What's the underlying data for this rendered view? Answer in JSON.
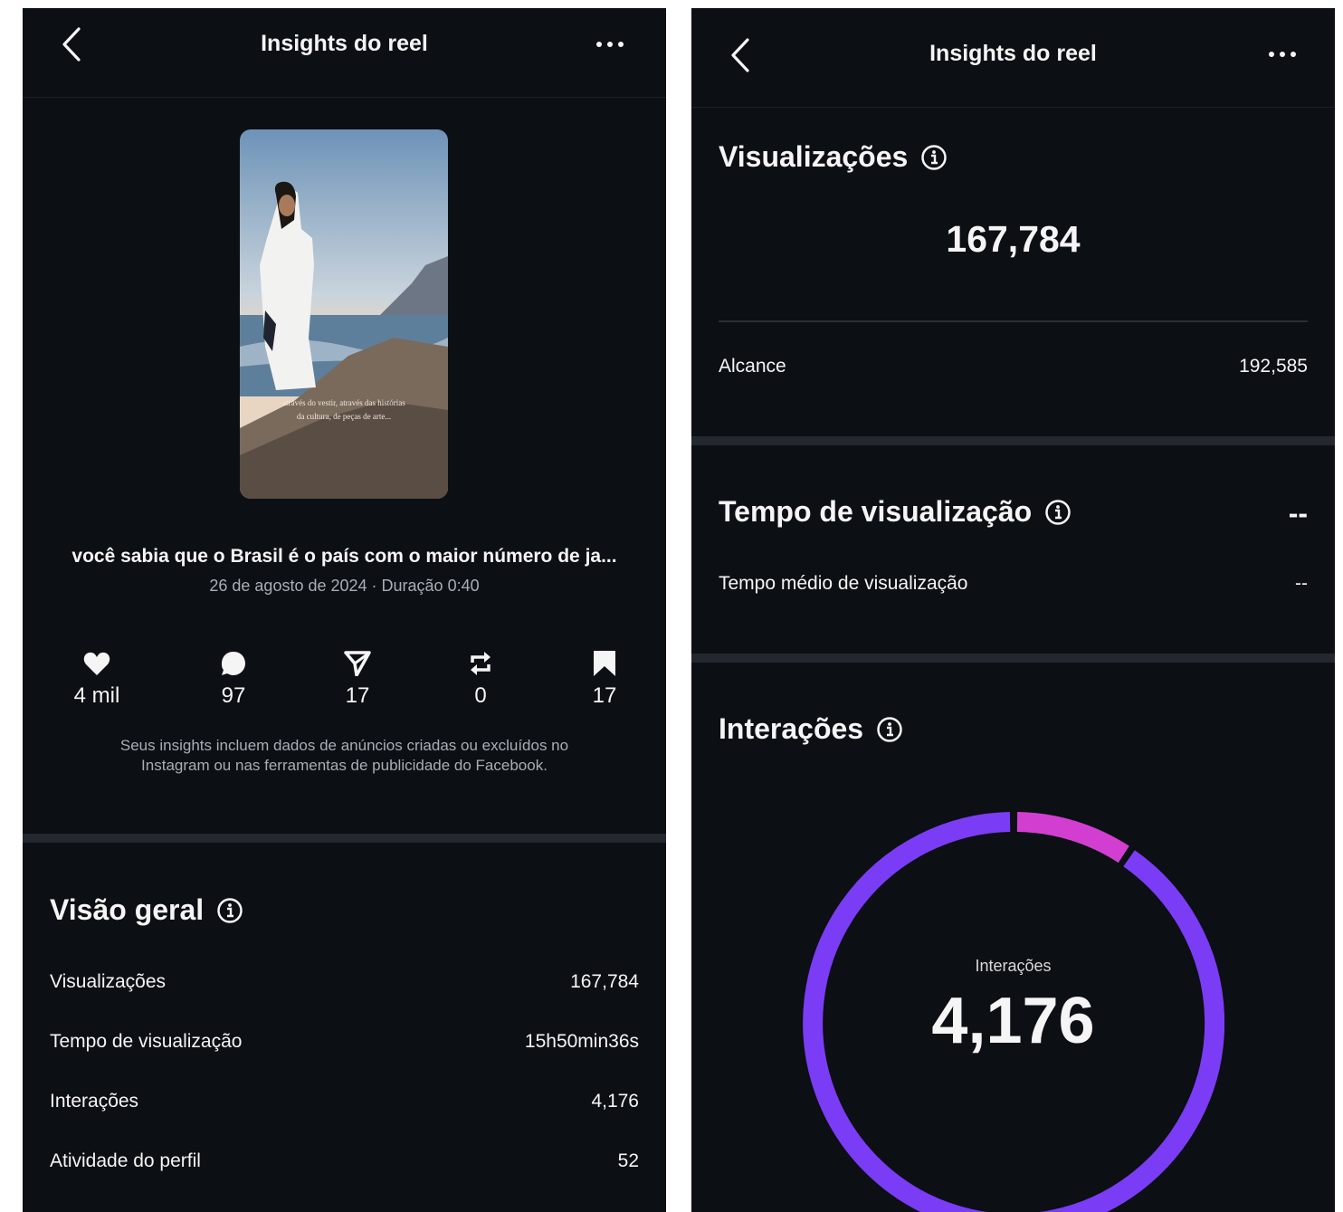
{
  "left": {
    "header": {
      "title": "Insights do reel"
    },
    "reel": {
      "thumbnail_text_line1": "através do vestir, através das histórias",
      "thumbnail_text_line2": "da cultura, de peças de arte...",
      "title": "você sabia que o Brasil é o país com o maior número de ja...",
      "date_duration": "26 de agosto de 2024 · Duração 0:40"
    },
    "stats": [
      {
        "icon": "heart-icon",
        "value": "4 mil"
      },
      {
        "icon": "comment-icon",
        "value": "97"
      },
      {
        "icon": "share-icon",
        "value": "17"
      },
      {
        "icon": "repost-icon",
        "value": "0"
      },
      {
        "icon": "bookmark-icon",
        "value": "17"
      }
    ],
    "note_line1": "Seus insights incluem dados de anúncios criadas ou excluídos no",
    "note_line2": "Instagram ou nas ferramentas de publicidade do Facebook.",
    "overview": {
      "title": "Visão geral",
      "rows": [
        {
          "label": "Visualizações",
          "value": "167,784"
        },
        {
          "label": "Tempo de visualização",
          "value": "15h50min36s"
        },
        {
          "label": "Interações",
          "value": "4,176"
        },
        {
          "label": "Atividade do perfil",
          "value": "52"
        }
      ]
    }
  },
  "right": {
    "header": {
      "title": "Insights do reel"
    },
    "views": {
      "title": "Visualizações",
      "value": "167,784",
      "reach_label": "Alcance",
      "reach_value": "192,585"
    },
    "watch_time": {
      "title": "Tempo de visualização",
      "value": "--",
      "avg_label": "Tempo médio de visualização",
      "avg_value": "--"
    },
    "interactions": {
      "title": "Interações",
      "donut_label": "Interações",
      "donut_value": "4,176"
    }
  },
  "colors": {
    "background": "#0c0f14",
    "divider": "#23272e",
    "muted_text": "#a8aeb6",
    "ring_primary": "#7b3cf5",
    "ring_secondary": "#d23fd0"
  }
}
